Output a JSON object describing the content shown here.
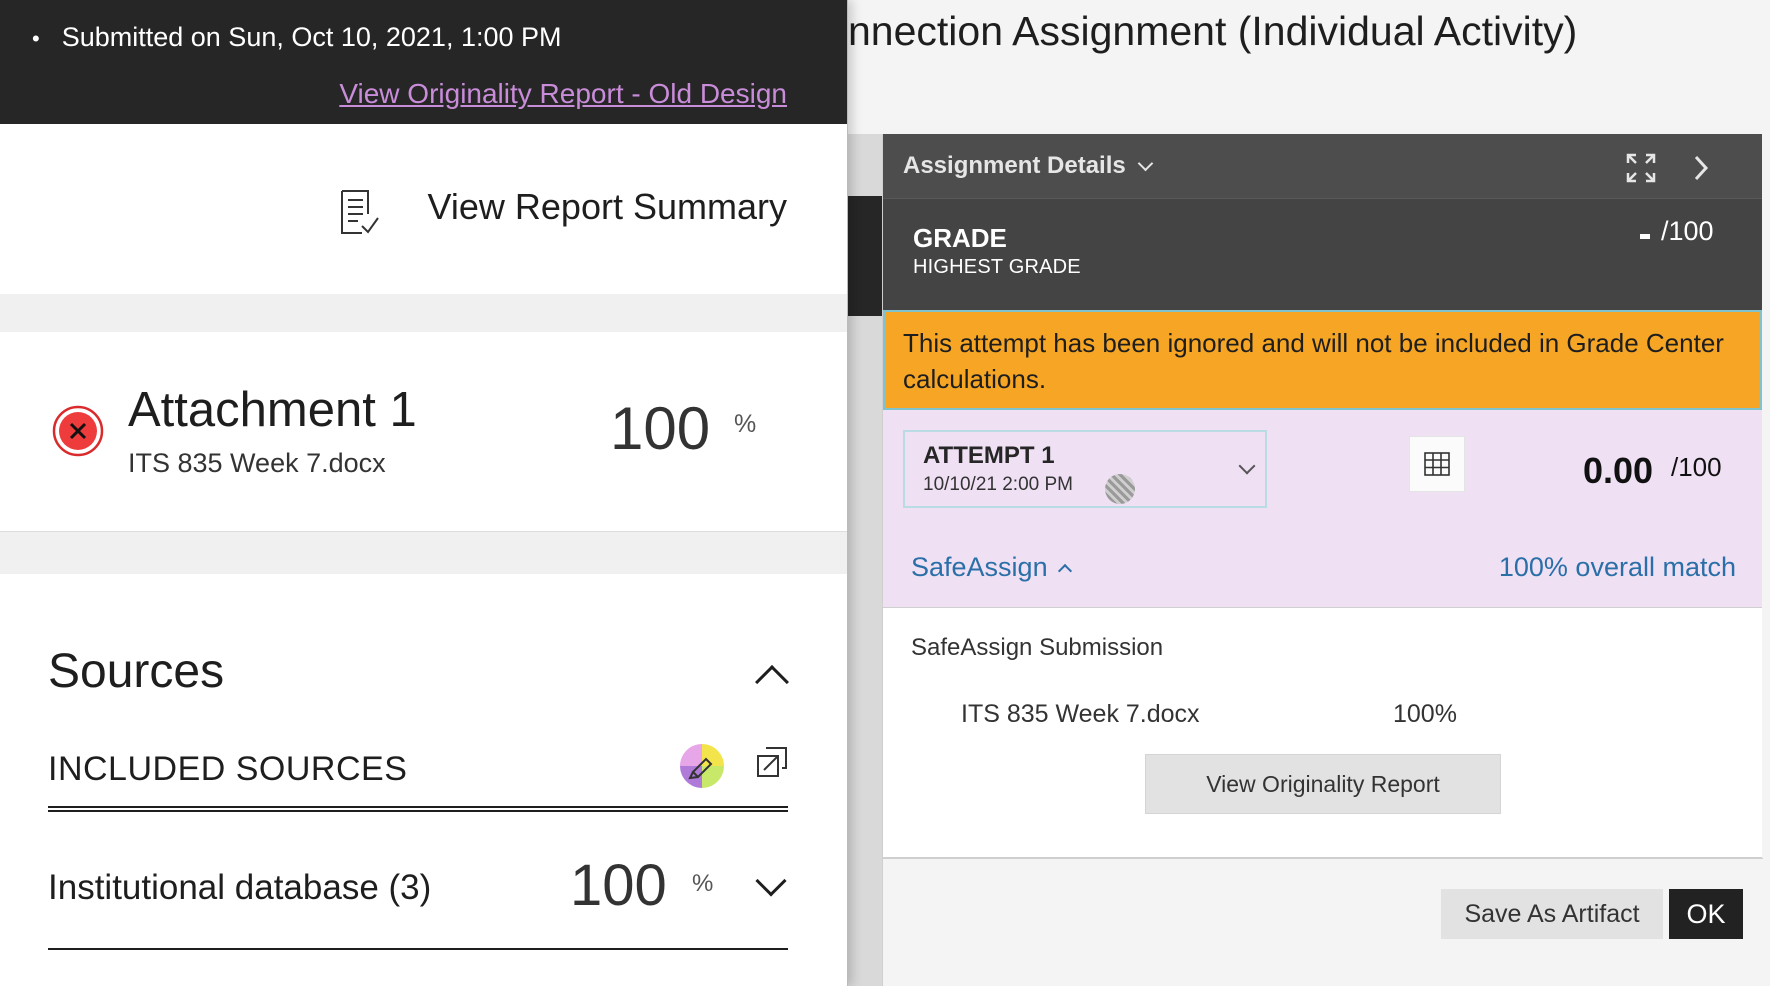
{
  "background": {
    "page_title": "nnection Assignment (Individual Activity)"
  },
  "panel": {
    "header_title": "Assignment Details",
    "expand_icon": "expand-icon",
    "next_icon": "chevron-right-icon",
    "grade_label": "GRADE",
    "grade_sub": "HIGHEST GRADE",
    "grade_denominator": "/100",
    "banner_text": "This attempt has been ignored and will not be included in Grade Center calculations.",
    "attempt_label": "ATTEMPT 1",
    "attempt_date": "10/10/21 2:00 PM",
    "score": "0.00",
    "score_denominator": "/100",
    "safeassign_label": "SafeAssign",
    "overall_match": "100% overall match",
    "submission_title": "SafeAssign Submission",
    "submission_file": "ITS 835 Week 7.docx",
    "submission_pct": "100%",
    "view_report_button": "View Originality Report",
    "save_artifact_button": "Save As Artifact",
    "ok_button": "OK"
  },
  "report": {
    "submitted_text": "Submitted on Sun, Oct 10, 2021, 1:00 PM",
    "old_design_link": "View Originality Report - Old Design",
    "view_summary": "View Report Summary",
    "attachment_name": "Attachment 1",
    "attachment_file": "ITS 835 Week 7.docx",
    "attachment_pct": "100",
    "percent_sign": "%",
    "sources_title": "Sources",
    "included_sources": "INCLUDED SOURCES",
    "institutional_db": "Institutional database (3)",
    "institutional_pct": "100"
  },
  "colors": {
    "warning": "#f6a524",
    "link_blue": "#2a6fa7",
    "link_purple": "#c98cd9",
    "attempt_bg": "#efe0f4",
    "dark_header": "#4d4d4d"
  }
}
